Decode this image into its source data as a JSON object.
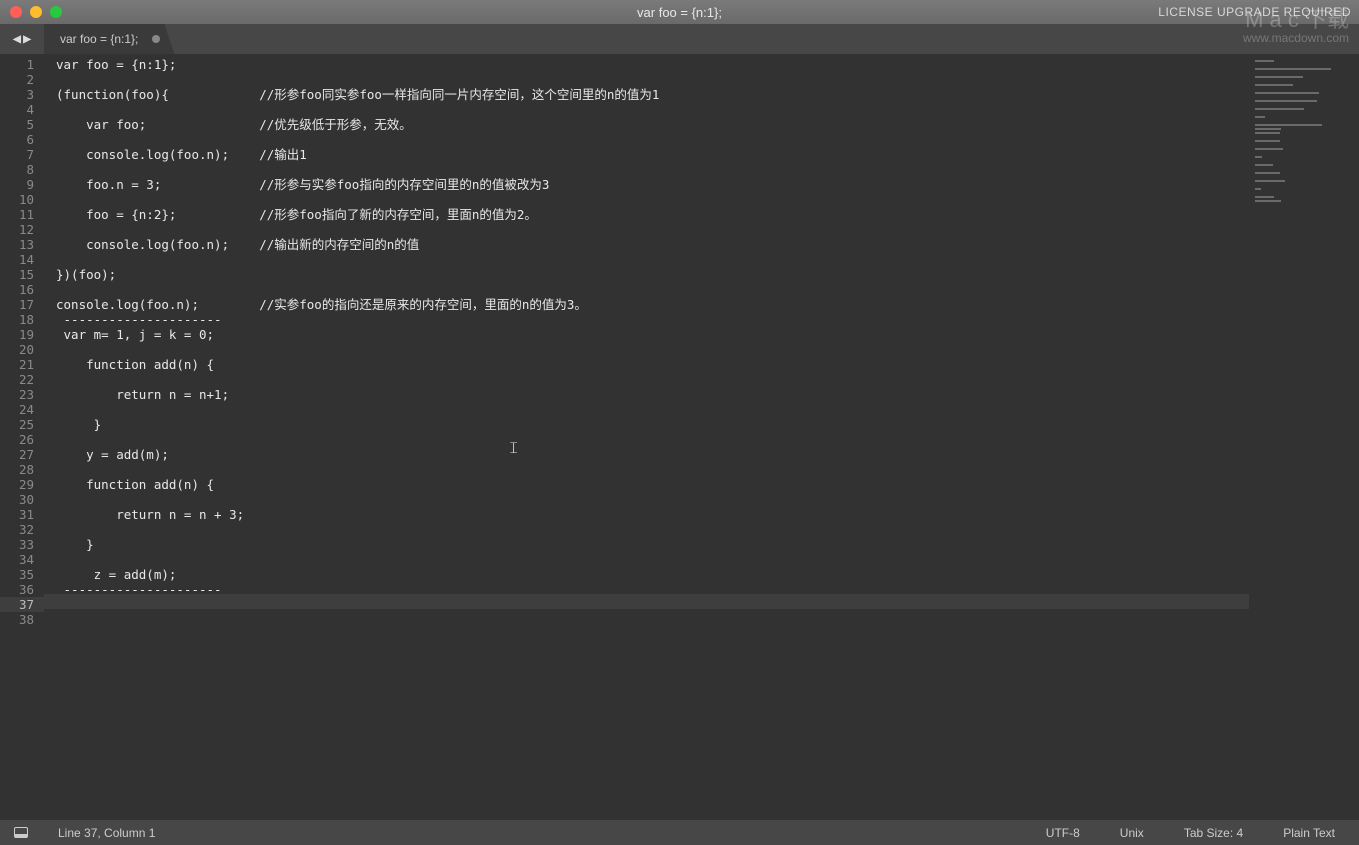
{
  "window": {
    "title": "var foo = {n:1};",
    "license_notice": "LICENSE UPGRADE REQUIRED",
    "watermark_main": "M a c 下载",
    "watermark_sub": "www.macdown.com"
  },
  "tabs": [
    {
      "label": "var foo = {n:1};",
      "dirty": true
    }
  ],
  "editor": {
    "highlighted_line": 37,
    "total_lines": 38,
    "lines": [
      "var foo = {n:1};",
      "",
      "(function(foo){            //形参foo同实参foo一样指向同一片内存空间，这个空间里的n的值为1",
      "",
      "    var foo;               //优先级低于形参，无效。",
      "",
      "    console.log(foo.n);    //输出1",
      "",
      "    foo.n = 3;             //形参与实参foo指向的内存空间里的n的值被改为3",
      "",
      "    foo = {n:2};           //形参foo指向了新的内存空间，里面n的值为2。",
      "",
      "    console.log(foo.n);    //输出新的内存空间的n的值",
      "",
      "})(foo);",
      "",
      "console.log(foo.n);        //实参foo的指向还是原来的内存空间，里面的n的值为3。",
      " ---------------------",
      " var m= 1, j = k = 0;",
      " ",
      "    function add(n) {",
      " ",
      "        return n = n+1;",
      " ",
      "     }",
      "",
      "    y = add(m);",
      " ",
      "    function add(n) {",
      " ",
      "        return n = n + 3;",
      " ",
      "    }",
      "",
      "     z = add(m);",
      " ---------------------",
      "",
      ""
    ]
  },
  "statusbar": {
    "cursor": "Line 37, Column 1",
    "encoding": "UTF-8",
    "line_endings": "Unix",
    "indent": "Tab Size: 4",
    "syntax": "Plain Text"
  }
}
